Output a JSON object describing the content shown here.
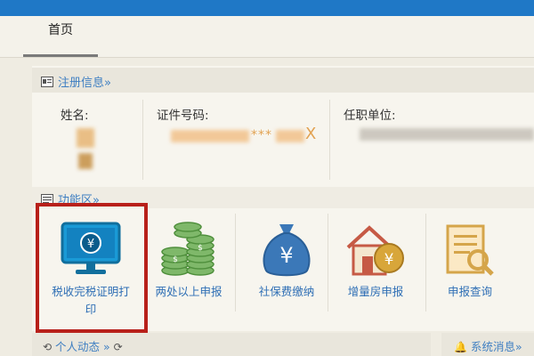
{
  "tabs": {
    "home": "首页"
  },
  "registration": {
    "header": "注册信息»",
    "name_label": "姓名:",
    "id_label": "证件号码:",
    "id_value_visible": "***",
    "id_suffix": "X",
    "employer_label": "任职单位:"
  },
  "functions": {
    "header": "功能区»",
    "items": [
      {
        "label_line1": "税收完税证明打",
        "label_line2": "印",
        "icon": "monitor-yuan-icon"
      },
      {
        "label": "两处以上申报",
        "icon": "coin-stacks-icon"
      },
      {
        "label": "社保费缴纳",
        "icon": "money-bag-icon"
      },
      {
        "label": "增量房申报",
        "icon": "house-yuan-icon"
      },
      {
        "label": "申报查询",
        "icon": "document-search-icon"
      }
    ]
  },
  "bottom": {
    "personal": "个人动态 »",
    "system": "系统消息»"
  },
  "colors": {
    "accent": "#1f78c6",
    "link": "#3f7fc2",
    "highlight": "#b8201a"
  }
}
